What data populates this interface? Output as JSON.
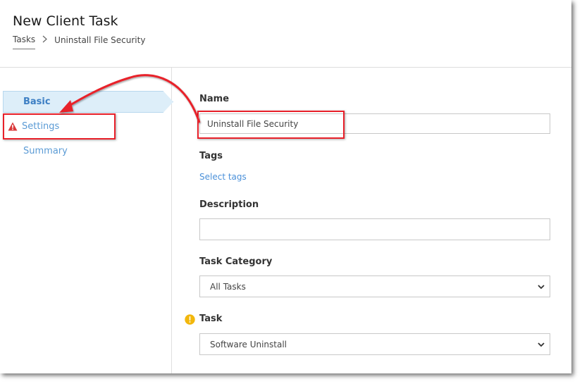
{
  "header": {
    "title": "New Client Task",
    "breadcrumb": {
      "link": "Tasks",
      "current": "Uninstall File Security"
    }
  },
  "sidebar": {
    "items": [
      {
        "label": "Basic",
        "state": "active"
      },
      {
        "label": "Settings",
        "state": "warning"
      },
      {
        "label": "Summary",
        "state": "normal"
      }
    ]
  },
  "form": {
    "name": {
      "label": "Name",
      "value": "Uninstall File Security"
    },
    "tags": {
      "label": "Tags",
      "link": "Select tags"
    },
    "description": {
      "label": "Description",
      "value": ""
    },
    "category": {
      "label": "Task Category",
      "selected": "All Tasks"
    },
    "task": {
      "label": "Task",
      "selected": "Software Uninstall"
    }
  },
  "colors": {
    "accent": "#5b9bd5",
    "active_bg": "#ddeef9",
    "warning": "#d9383a",
    "info": "#f2b70c",
    "annotation": "#e8202a"
  }
}
